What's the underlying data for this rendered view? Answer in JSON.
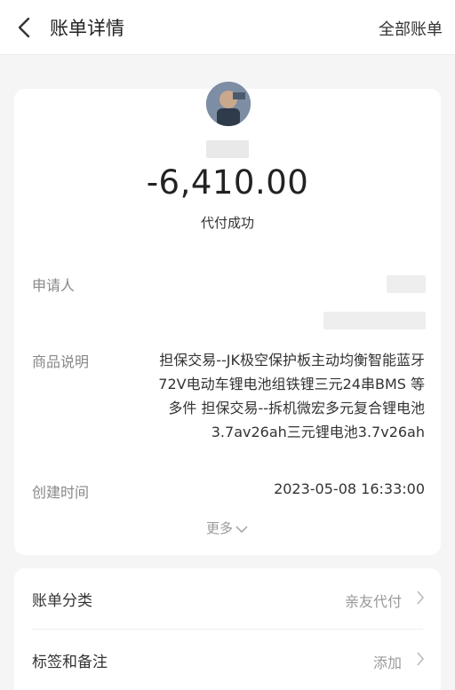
{
  "nav": {
    "title": "账单详情",
    "right_link": "全部账单"
  },
  "summary": {
    "amount": "-6,410.00",
    "status": "代付成功"
  },
  "details": {
    "applicant_label": "申请人",
    "product_label": "商品说明",
    "product_lines": [
      "担保交易--JK极空保护板主动均衡智能蓝牙",
      "72V电动车锂电池组铁锂三元24串BMS 等",
      "多件 担保交易--拆机微宏多元复合锂电池",
      "3.7av26ah三元锂电池3.7v26ah"
    ],
    "created_label": "创建时间",
    "created_value": "2023-05-08 16:33:00",
    "more_label": "更多"
  },
  "list": [
    {
      "label": "账单分类",
      "value": "亲友代付"
    },
    {
      "label": "标签和备注",
      "value": "添加"
    }
  ],
  "colors": {
    "background": "#f5f5f5",
    "card": "#ffffff",
    "muted": "#999999"
  }
}
